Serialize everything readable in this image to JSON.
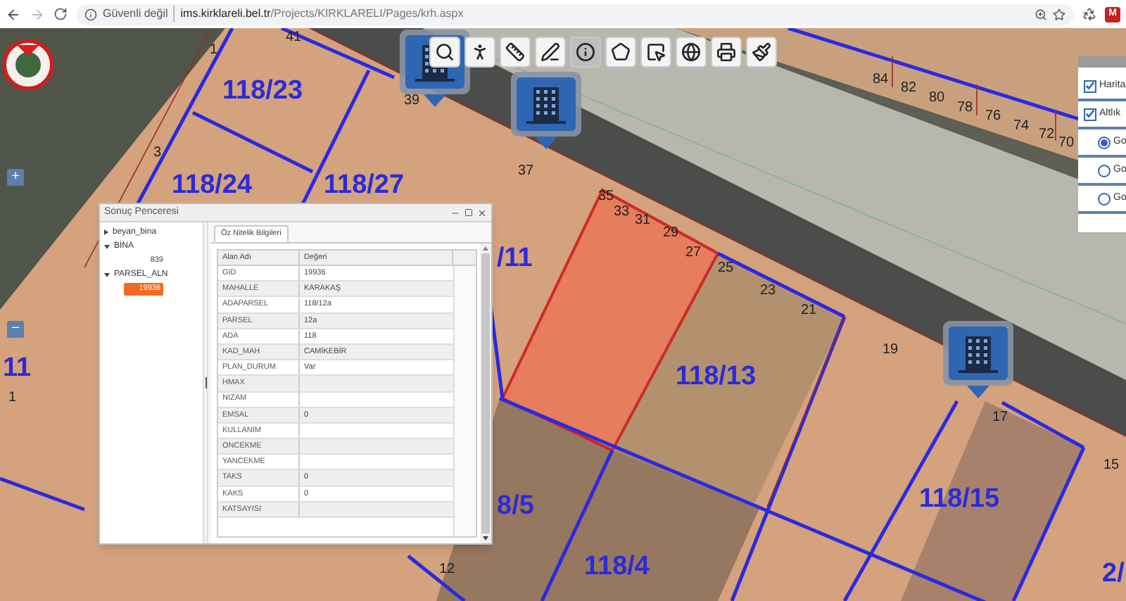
{
  "browser": {
    "security_label": "Güvenli değil",
    "url_host": "ims.kirklareli.bel.tr",
    "url_path": "/Projects/KIRKLARELI/Pages/krh.aspx",
    "extension_badge": "M"
  },
  "toolbar": [
    {
      "kind": "search",
      "selected": false
    },
    {
      "kind": "streetview",
      "selected": false
    },
    {
      "kind": "measure",
      "selected": false
    },
    {
      "kind": "draw",
      "selected": false
    },
    {
      "kind": "info",
      "selected": true
    },
    {
      "kind": "query",
      "selected": false
    },
    {
      "kind": "select",
      "selected": false
    },
    {
      "kind": "globe",
      "selected": false
    },
    {
      "kind": "print",
      "selected": false
    },
    {
      "kind": "clear",
      "selected": false
    }
  ],
  "map": {
    "zoom_in": "+",
    "zoom_out": "−",
    "parcel_labels": [
      "118/23",
      "118/24",
      "118/27",
      "/11",
      "118/13",
      "8/5",
      "118/4",
      "118/15",
      "11",
      "2/"
    ],
    "door_numbers": [
      "41",
      "1",
      "3",
      "39",
      "37",
      "35",
      "33",
      "31",
      "29",
      "27",
      "25",
      "23",
      "21",
      "19",
      "17",
      "15",
      "12",
      "1",
      "84",
      "82",
      "80",
      "78",
      "76",
      "74",
      "72",
      "70"
    ]
  },
  "layers_panel": {
    "items": [
      {
        "kind": "checkbox",
        "label": "Harita",
        "checked": true
      },
      {
        "kind": "checkbox",
        "label": "Altlık",
        "checked": true
      },
      {
        "kind": "radio",
        "label": "Go",
        "selected": true
      },
      {
        "kind": "radio",
        "label": "Go",
        "selected": false
      },
      {
        "kind": "radio",
        "label": "Go",
        "selected": false
      }
    ]
  },
  "popup": {
    "title": "Sonuç Penceresi",
    "tree": [
      {
        "label": "beyan_bina",
        "expanded": false,
        "selected": false
      },
      {
        "label": "BİNA",
        "expanded": true,
        "selected": false,
        "children": [
          {
            "label": "839",
            "selected": false
          }
        ]
      },
      {
        "label": "PARSEL_ALN",
        "expanded": true,
        "selected": false,
        "children": [
          {
            "label": "19936",
            "selected": true
          }
        ]
      }
    ],
    "tabs": [
      {
        "label": "Öz Nitelik Bilgileri",
        "selected": true
      }
    ],
    "columns": [
      "Alan Adı",
      "Değeri"
    ],
    "rows": [
      {
        "field": "GID",
        "value": "19936"
      },
      {
        "field": "MAHALLE",
        "value": "KARAKAŞ"
      },
      {
        "field": "ADAPARSEL",
        "value": "118/12a"
      },
      {
        "field": "PARSEL",
        "value": "12a"
      },
      {
        "field": "ADA",
        "value": "118"
      },
      {
        "field": "KAD_MAH",
        "value": "CAMİKEBİR"
      },
      {
        "field": "PLAN_DURUM",
        "value": "Var"
      },
      {
        "field": "HMAX"
      },
      {
        "field": "NIZAM"
      },
      {
        "field": "EMSAL",
        "value": "0"
      },
      {
        "field": "KULLANIM"
      },
      {
        "field": "ONCEKME"
      },
      {
        "field": "YANCEKME"
      },
      {
        "field": "TAKS",
        "value": "0"
      },
      {
        "field": "KAKS",
        "value": "0"
      },
      {
        "field": "KATSAYISI"
      }
    ]
  }
}
